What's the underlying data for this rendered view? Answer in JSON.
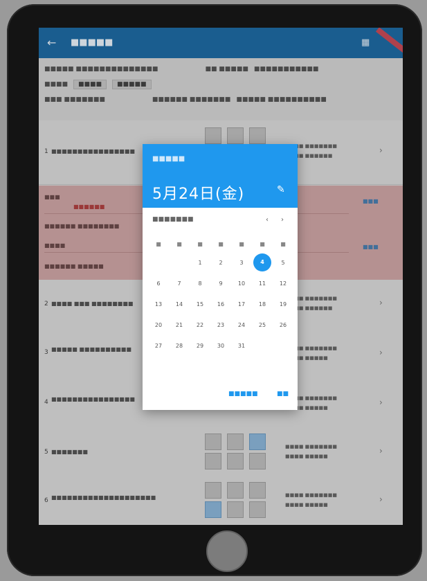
{
  "app": {
    "back_icon": "arrow-left-icon",
    "title": "■■■■■",
    "grid_icon": "grid-icon"
  },
  "info": {
    "row1": [
      "■■■■■ ■■■■■■■■■■■■■■",
      "■■ ■■■■■",
      "■■■■■■■■■■■"
    ],
    "row2_label": "■■■■",
    "row2_values": [
      "■■■■",
      "■■■■■"
    ],
    "row3": [
      "■■■ ■■■■■■■",
      "■■■■■■ ■■■■■■■",
      "■■■■■ ■■■■■■■■■■"
    ]
  },
  "dialog": {
    "year": "■■■■■",
    "date": "5月24日(金)",
    "edit_icon": "pencil-icon",
    "month": "■■■■■■■",
    "prev_icon": "chevron-left-icon",
    "next_icon": "chevron-right-icon",
    "weekdays": [
      "■",
      "■",
      "■",
      "■",
      "■",
      "■",
      "■"
    ],
    "weeks": [
      [
        "",
        "",
        "1",
        "2",
        "3",
        "4",
        "5"
      ],
      [
        "6",
        "7",
        "8",
        "9",
        "10",
        "11",
        "12"
      ],
      [
        "13",
        "14",
        "15",
        "16",
        "17",
        "18",
        "19"
      ],
      [
        "20",
        "21",
        "22",
        "23",
        "24",
        "25",
        "26"
      ],
      [
        "27",
        "28",
        "29",
        "30",
        "31",
        "",
        ""
      ]
    ],
    "selected_day": "4",
    "cancel_label": "■■■■■",
    "ok_label": "■■"
  },
  "items": [
    {
      "num": "1",
      "text": "■■■■■■■■■■■■■■■■",
      "meta": [
        "■■■■ ■■■■■■■",
        "■■■■ ■■■■■■"
      ]
    },
    {
      "num": "2",
      "text": "■■■■ ■■■ ■■■■■■■■",
      "meta": [
        "■■■■ ■■■■■■■",
        "■■■■ ■■■■■■"
      ]
    },
    {
      "num": "3",
      "text": "■■■■■ ■■■■■■■■■■",
      "meta": [
        "■■■■ ■■■■■■■",
        "■■■■ ■■■■■"
      ]
    },
    {
      "num": "4",
      "text": "■■■■■■■■■■■■■■■■",
      "meta": [
        "■■■■ ■■■■■■■",
        "■■■■ ■■■■■"
      ]
    },
    {
      "num": "5",
      "text": "■■■■■■■",
      "meta": [
        "■■■■ ■■■■■■■",
        "■■■■ ■■■■■"
      ]
    },
    {
      "num": "6",
      "text": "■■■■■■■■■■■■■■■■■■■■",
      "meta": [
        "■■■■ ■■■■■■■",
        "■■■■ ■■■■■"
      ]
    }
  ],
  "pink": {
    "line1": "■■■",
    "line1b": "■■■■■■",
    "line2": "■■■■■■ ■■■■■■■■",
    "line3": "■■■■",
    "line4": "■■■■■■ ■■■■■",
    "link1": "■■■",
    "link2": "■■■"
  }
}
